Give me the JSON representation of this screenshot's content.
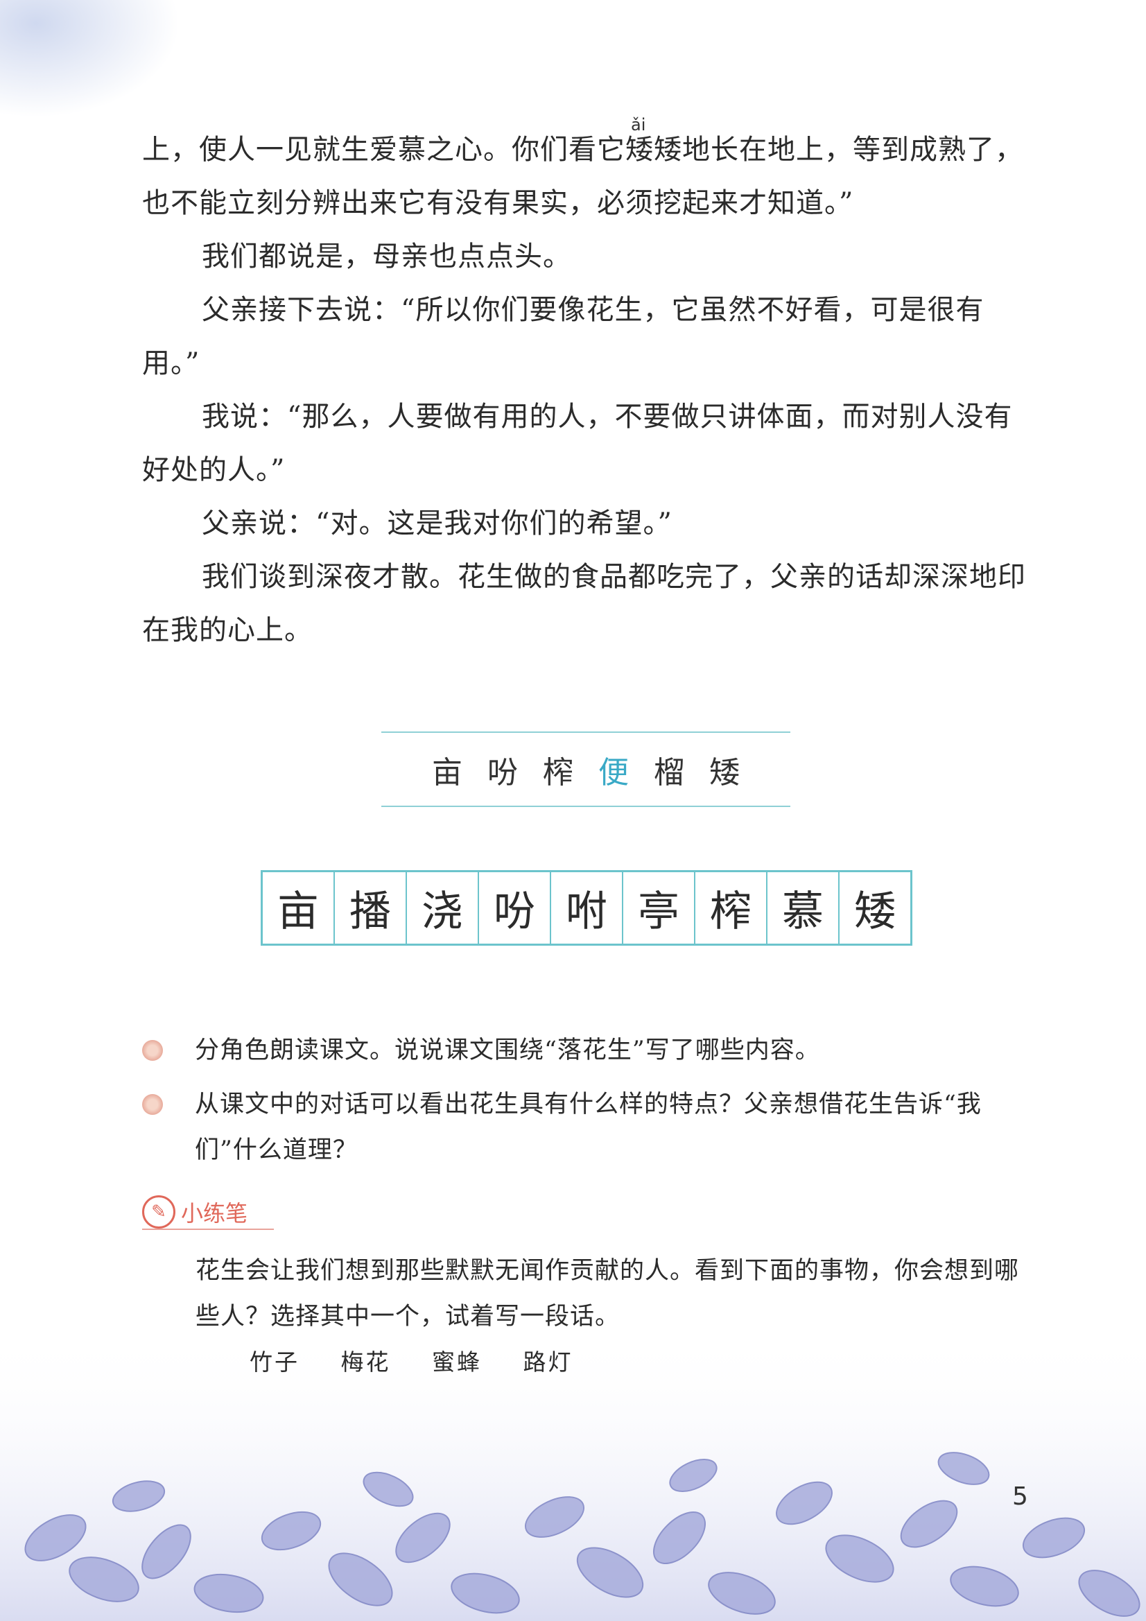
{
  "text": {
    "line1_before": "上，使人一见就生爱慕之心。你们看它",
    "line1_word": "矮",
    "line1_after": "矮地长在地上，等到成熟了，也不能立刻分辨出来它有没有果实，必须挖起来才知道。”",
    "pinyin_ai": "ǎi",
    "p2": "我们都说是，母亲也点点头。",
    "p3": "父亲接下去说：“所以你们要像花生，它虽然不好看，可是很有用。”",
    "p4": "我说：“那么，人要做有用的人，不要做只讲体面，而对别人没有好处的人。”",
    "p5": "父亲说：“对。这是我对你们的希望。”",
    "p6": "我们谈到深夜才散。花生做的食品都吃完了，父亲的话却深深地印在我的心上。"
  },
  "recognize_chars": [
    "亩",
    "吩",
    "榨",
    "便",
    "榴",
    "矮"
  ],
  "highlight_color": "#3aa9c6",
  "write_chars": [
    "亩",
    "播",
    "浇",
    "吩",
    "咐",
    "亭",
    "榨",
    "慕",
    "矮"
  ],
  "questions": [
    "分角色朗读课文。说说课文围绕“落花生”写了哪些内容。",
    "从课文中的对话可以看出花生具有什么样的特点？父亲想借花生告诉“我们”什么道理？"
  ],
  "practice": {
    "title": "小练笔",
    "text": "花生会让我们想到那些默默无闻作贡献的人。看到下面的事物，你会想到哪些人？选择其中一个，试着写一段话。",
    "items": [
      "竹子",
      "梅花",
      "蜜蜂",
      "路灯"
    ]
  },
  "page_number": "5"
}
